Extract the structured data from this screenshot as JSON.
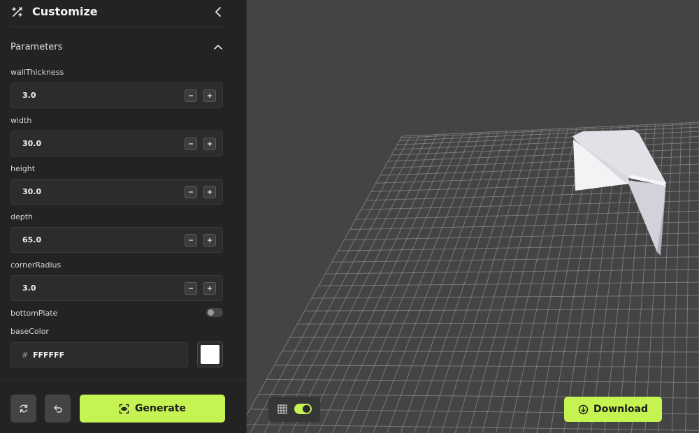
{
  "colors": {
    "accent": "#c4f352",
    "sidebar_bg": "#232323",
    "viewport_bg": "#444444",
    "grid_line": "#8a8a8a",
    "model_color": "#FFFFFF"
  },
  "header": {
    "title": "Customize",
    "logo_icon": "wand-sparkle-icon",
    "collapse_icon": "chevron-left-icon"
  },
  "parameters": {
    "title": "Parameters",
    "toggle_icon": "chevron-up-icon",
    "fields": [
      {
        "label": "wallThickness",
        "value": "3.0"
      },
      {
        "label": "width",
        "value": "30.0"
      },
      {
        "label": "height",
        "value": "30.0"
      },
      {
        "label": "depth",
        "value": "65.0"
      },
      {
        "label": "cornerRadius",
        "value": "3.0"
      }
    ],
    "bottomPlate": {
      "label": "bottomPlate",
      "enabled": false
    },
    "baseColor": {
      "label": "baseColor",
      "hash": "#",
      "hex": "FFFFFF"
    }
  },
  "footer": {
    "reset_icon": "refresh-icon",
    "undo_icon": "undo-icon",
    "generate_label": "Generate",
    "generate_icon": "scan-eye-icon"
  },
  "viewport": {
    "grid_icon": "grid-icon",
    "grid_visible": true,
    "download_label": "Download",
    "download_icon": "download-circle-icon"
  }
}
